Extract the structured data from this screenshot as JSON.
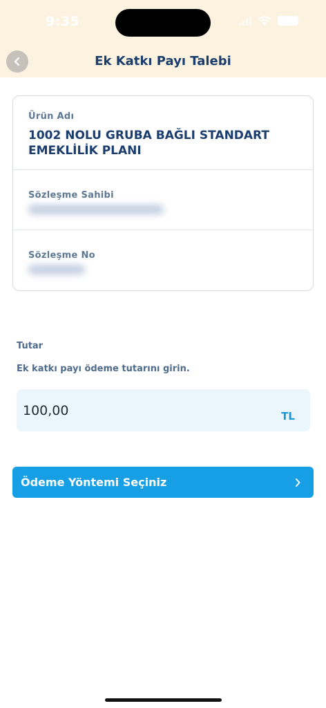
{
  "status_bar": {
    "time": "9:35"
  },
  "header": {
    "title": "Ek Katkı Payı Talebi"
  },
  "contract_card": {
    "product_label": "Ürün Adı",
    "product_value": "1002 NOLU GRUBA BAĞLI STANDART EMEKLİLİK PLANI",
    "owner_label": "Sözleşme Sahibi",
    "number_label": "Sözleşme No"
  },
  "amount_section": {
    "label": "Tutar",
    "instruction": "Ek katkı payı ödeme tutarını girin.",
    "value": "100,00",
    "currency": "TL"
  },
  "payment_button": {
    "label": "Ödeme Yöntemi Seçiniz"
  },
  "colors": {
    "header_bg": "#fbf2df",
    "title": "#1b3d6e",
    "accent": "#169fe4",
    "input_bg": "#eaf5fc"
  }
}
